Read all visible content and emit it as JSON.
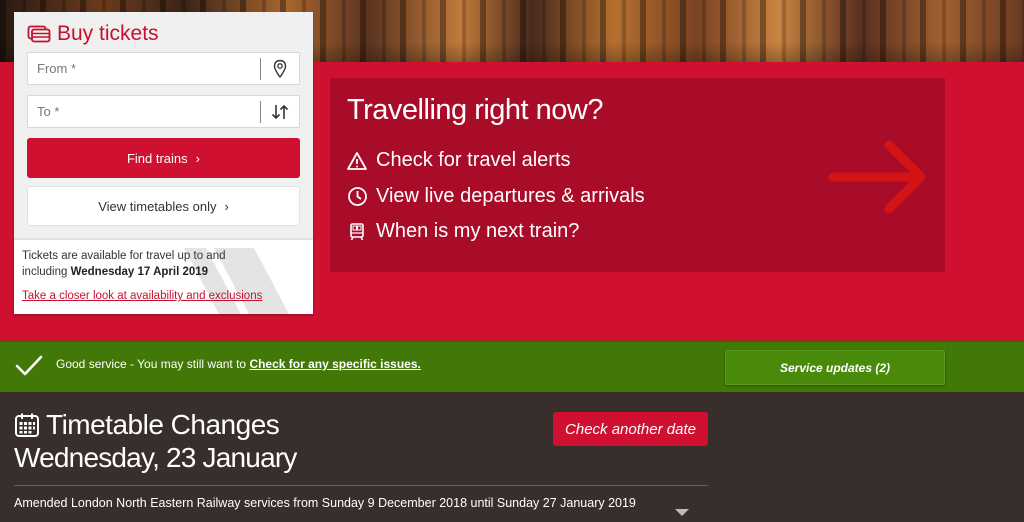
{
  "buy_tickets": {
    "title": "Buy tickets",
    "title_icon": "tickets-icon",
    "from_placeholder": "From *",
    "from_value": "",
    "from_icon": "location-pin-icon",
    "to_placeholder": "To *",
    "to_value": "",
    "to_icon": "swap-arrows-icon",
    "find_trains_label": "Find trains",
    "view_timetables_label": "View timetables only",
    "availability_text": "Tickets are available for travel up to and including",
    "availability_date": "Wednesday 17 April 2019",
    "availability_link": "Take a closer look at availability and exclusions"
  },
  "travelling": {
    "heading": "Travelling right now?",
    "items": [
      {
        "icon": "warning-icon",
        "label": "Check for travel alerts"
      },
      {
        "icon": "clock-icon",
        "label": "View live departures & arrivals"
      },
      {
        "icon": "train-icon",
        "label": "When is my next train?"
      }
    ],
    "arrow_icon": "arrow-right-icon"
  },
  "status_bar": {
    "icon": "checkmark-icon",
    "message": "Good service - You may still want to",
    "link": "Check for any specific issues.",
    "updates_button": "Service updates (2)"
  },
  "timetable": {
    "icon": "calendar-icon",
    "title": "Timetable Changes",
    "date": "Wednesday, 23 January",
    "check_date_button": "Check another date",
    "rows": [
      {
        "text": "Amended London North Eastern Railway services from Sunday 9 December 2018 until Sunday 27 January 2019"
      }
    ]
  },
  "colors": {
    "brand_red": "#cf1030",
    "panel_red": "#a80c28",
    "status_green": "#427808",
    "dark_bg": "#382e2c"
  }
}
